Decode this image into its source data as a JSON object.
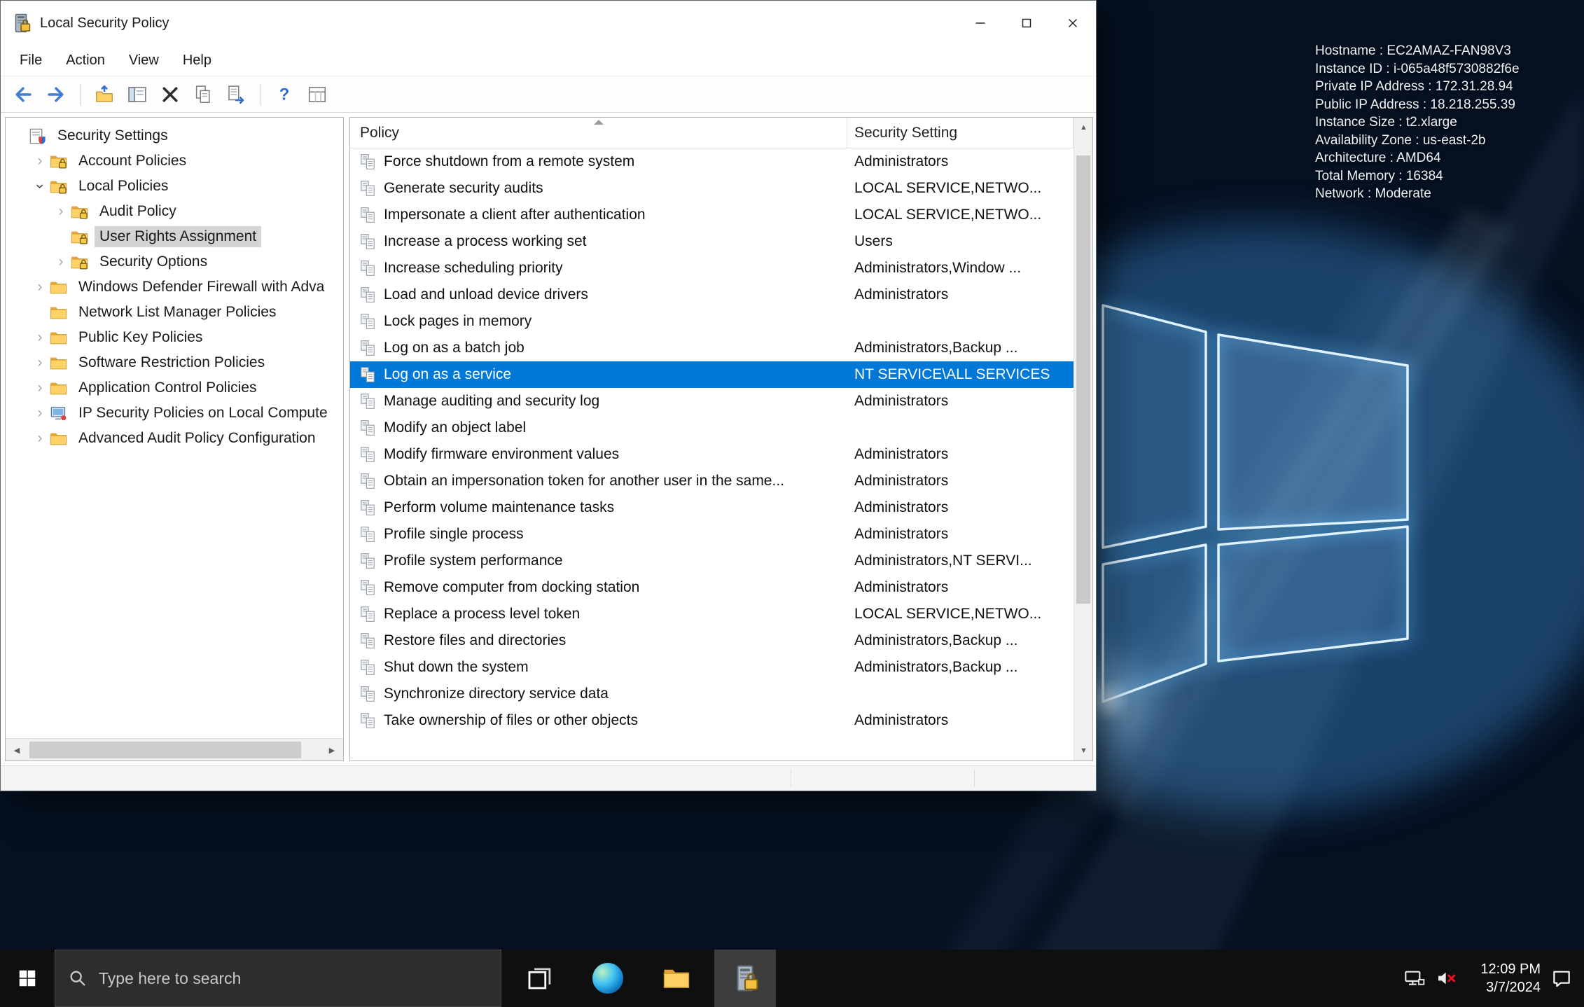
{
  "colors": {
    "selection": "#0078d7",
    "tree_selection": "#d4d4d4",
    "taskbar_bg": "#0f0f0f",
    "accent_blue": "#76b9ed"
  },
  "window": {
    "title": "Local Security Policy",
    "menu": [
      "File",
      "Action",
      "View",
      "Help"
    ],
    "toolbar": [
      "back",
      "forward",
      "sep",
      "up-level",
      "show-console-tree",
      "delete",
      "properties",
      "export-list",
      "sep",
      "help",
      "icon-view"
    ],
    "tree": [
      {
        "label": "Security Settings",
        "depth": 0,
        "expander": "none",
        "icon": "root",
        "selected": false
      },
      {
        "label": "Account Policies",
        "depth": 1,
        "expander": "collapsed",
        "icon": "folder-lock",
        "selected": false
      },
      {
        "label": "Local Policies",
        "depth": 1,
        "expander": "expanded",
        "icon": "folder-lock",
        "selected": false
      },
      {
        "label": "Audit Policy",
        "depth": 2,
        "expander": "collapsed",
        "icon": "folder-lock",
        "selected": false
      },
      {
        "label": "User Rights Assignment",
        "depth": 2,
        "expander": "none",
        "icon": "folder-lock",
        "selected": true
      },
      {
        "label": "Security Options",
        "depth": 2,
        "expander": "collapsed",
        "icon": "folder-lock",
        "selected": false
      },
      {
        "label": "Windows Defender Firewall with Adva",
        "depth": 1,
        "expander": "collapsed",
        "icon": "folder",
        "selected": false
      },
      {
        "label": "Network List Manager Policies",
        "depth": 1,
        "expander": "none",
        "icon": "folder",
        "selected": false
      },
      {
        "label": "Public Key Policies",
        "depth": 1,
        "expander": "collapsed",
        "icon": "folder",
        "selected": false
      },
      {
        "label": "Software Restriction Policies",
        "depth": 1,
        "expander": "collapsed",
        "icon": "folder",
        "selected": false
      },
      {
        "label": "Application Control Policies",
        "depth": 1,
        "expander": "collapsed",
        "icon": "folder",
        "selected": false
      },
      {
        "label": "IP Security Policies on Local Compute",
        "depth": 1,
        "expander": "collapsed",
        "icon": "ipsec",
        "selected": false
      },
      {
        "label": "Advanced Audit Policy Configuration",
        "depth": 1,
        "expander": "collapsed",
        "icon": "folder",
        "selected": false
      }
    ],
    "list": {
      "columns": {
        "policy": "Policy",
        "setting": "Security Setting"
      },
      "rows": [
        {
          "policy": "Force shutdown from a remote system",
          "setting": "Administrators",
          "selected": false
        },
        {
          "policy": "Generate security audits",
          "setting": "LOCAL SERVICE,NETWO...",
          "selected": false
        },
        {
          "policy": "Impersonate a client after authentication",
          "setting": "LOCAL SERVICE,NETWO...",
          "selected": false
        },
        {
          "policy": "Increase a process working set",
          "setting": "Users",
          "selected": false
        },
        {
          "policy": "Increase scheduling priority",
          "setting": "Administrators,Window ...",
          "selected": false
        },
        {
          "policy": "Load and unload device drivers",
          "setting": "Administrators",
          "selected": false
        },
        {
          "policy": "Lock pages in memory",
          "setting": "",
          "selected": false
        },
        {
          "policy": "Log on as a batch job",
          "setting": "Administrators,Backup ...",
          "selected": false
        },
        {
          "policy": "Log on as a service",
          "setting": "NT SERVICE\\ALL SERVICES",
          "selected": true
        },
        {
          "policy": "Manage auditing and security log",
          "setting": "Administrators",
          "selected": false
        },
        {
          "policy": "Modify an object label",
          "setting": "",
          "selected": false
        },
        {
          "policy": "Modify firmware environment values",
          "setting": "Administrators",
          "selected": false
        },
        {
          "policy": "Obtain an impersonation token for another user in the same...",
          "setting": "Administrators",
          "selected": false
        },
        {
          "policy": "Perform volume maintenance tasks",
          "setting": "Administrators",
          "selected": false
        },
        {
          "policy": "Profile single process",
          "setting": "Administrators",
          "selected": false
        },
        {
          "policy": "Profile system performance",
          "setting": "Administrators,NT SERVI...",
          "selected": false
        },
        {
          "policy": "Remove computer from docking station",
          "setting": "Administrators",
          "selected": false
        },
        {
          "policy": "Replace a process level token",
          "setting": "LOCAL SERVICE,NETWO...",
          "selected": false
        },
        {
          "policy": "Restore files and directories",
          "setting": "Administrators,Backup ...",
          "selected": false
        },
        {
          "policy": "Shut down the system",
          "setting": "Administrators,Backup ...",
          "selected": false
        },
        {
          "policy": "Synchronize directory service data",
          "setting": "",
          "selected": false
        },
        {
          "policy": "Take ownership of files or other objects",
          "setting": "Administrators",
          "selected": false
        }
      ]
    }
  },
  "desktop": {
    "info_lines": [
      "Hostname : EC2AMAZ-FAN98V3",
      "Instance ID : i-065a48f5730882f6e",
      "Private IP Address : 172.31.28.94",
      "Public IP Address : 18.218.255.39",
      "Instance Size : t2.xlarge",
      "Availability Zone : us-east-2b",
      "Architecture : AMD64",
      "Total Memory : 16384",
      "Network : Moderate"
    ]
  },
  "taskbar": {
    "search_placeholder": "Type here to search",
    "time": "12:09 PM",
    "date": "3/7/2024"
  }
}
